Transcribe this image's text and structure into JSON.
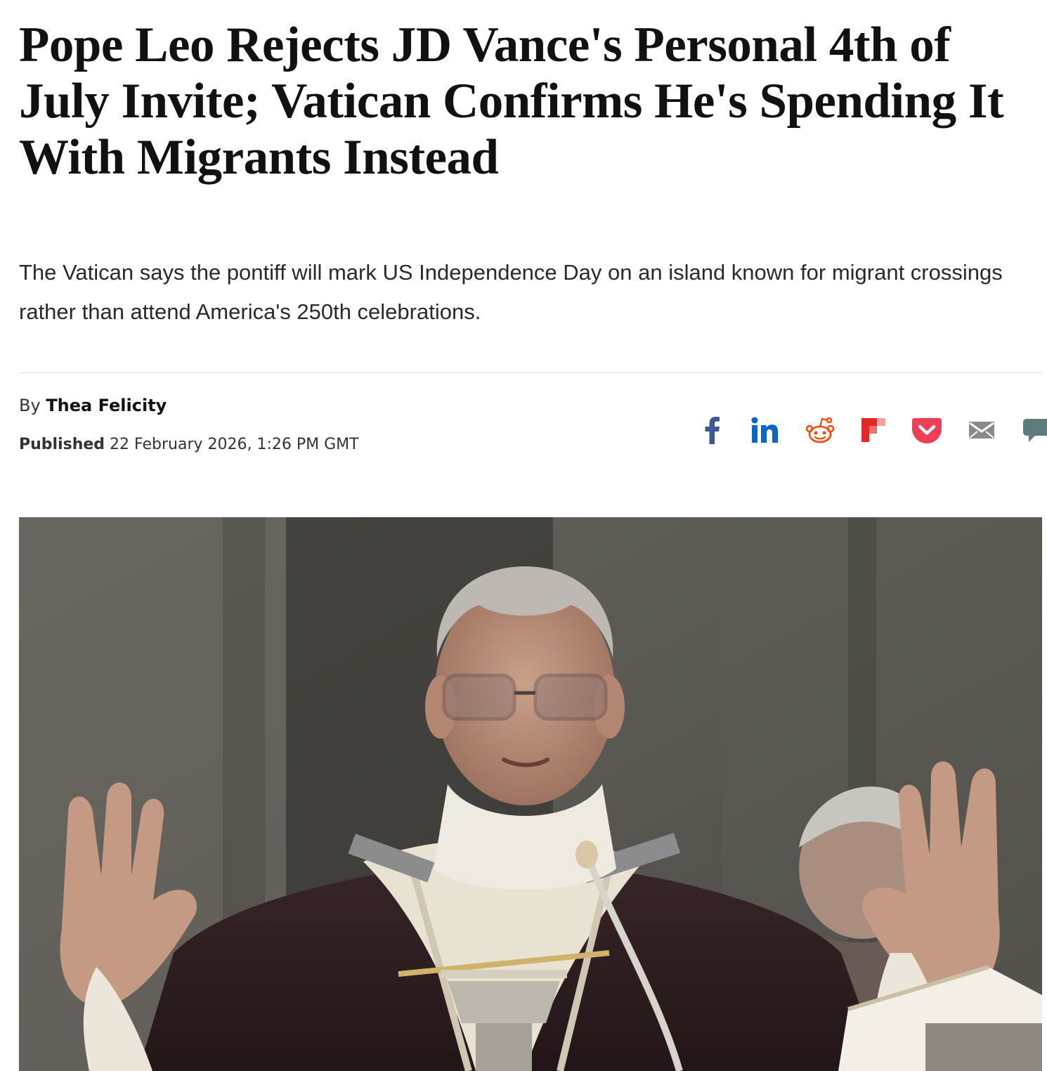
{
  "article": {
    "headline": "Pope Leo Rejects JD Vance's Personal 4th of July Invite; Vatican Confirms He's Spending It With Migrants Instead",
    "standfirst": "The Vatican says the pontiff will mark US Independence Day on an island known for migrant crossings rather than attend America's 250th celebrations.",
    "byline_prefix": "By",
    "author": "Thea Felicity",
    "published_label": "Published",
    "published_date": "22 February 2026, 1:26 PM GMT"
  },
  "share": {
    "buttons": [
      {
        "name": "facebook-icon",
        "color": "#3b5998"
      },
      {
        "name": "linkedin-icon",
        "color": "#0a66c2"
      },
      {
        "name": "reddit-icon",
        "color": "#ff4500"
      },
      {
        "name": "flipboard-icon",
        "color": "#e12828"
      },
      {
        "name": "pocket-icon",
        "color": "#ef3f56"
      },
      {
        "name": "email-icon",
        "color": "#8a8a8a"
      },
      {
        "name": "comment-icon",
        "color": "#5f7a7a"
      }
    ]
  },
  "hero_image": {
    "icon": "photo-of-pope-at-altar"
  }
}
